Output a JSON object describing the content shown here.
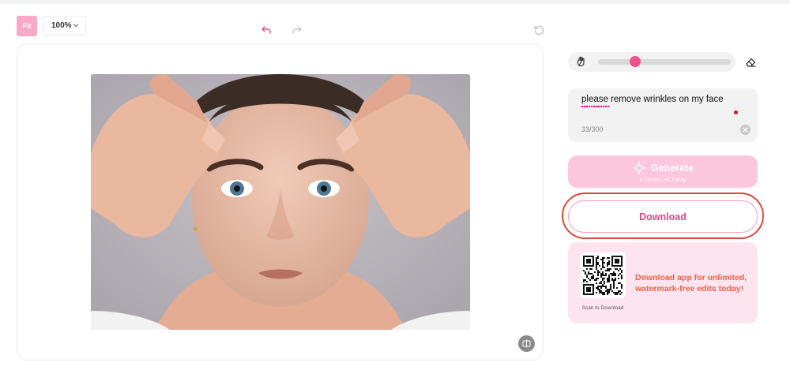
{
  "toolbar": {
    "fit_label": "Fit",
    "zoom_value": "100%"
  },
  "editor": {
    "image_alt": "Woman pulling eyebrows up with fingers showing forehead wrinkles"
  },
  "brush": {
    "size_fraction": 0.28
  },
  "prompt": {
    "text": "please remove wrinkles on my face",
    "char_count": "33/300"
  },
  "generate": {
    "label": "Generate",
    "remaining": "4 Times Left Today"
  },
  "download": {
    "label": "Download"
  },
  "promo": {
    "qr_caption": "Scan to Download",
    "message": "Download app for unlimited, watermark-free edits today!"
  },
  "colors": {
    "accent_pink": "#f04f8f",
    "generate_bg": "#fcc6dc",
    "highlight_ring": "#d84a3e",
    "promo_text": "#f06548"
  }
}
